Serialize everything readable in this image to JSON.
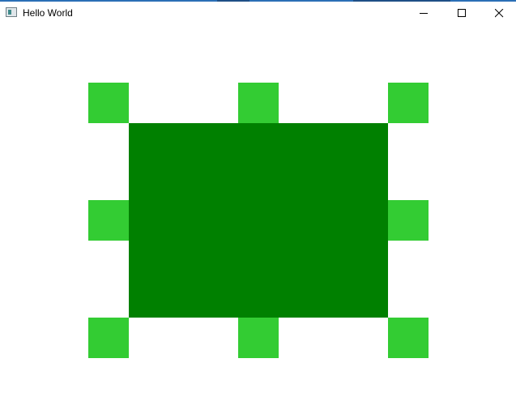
{
  "window": {
    "title": "Hello World",
    "icon": "app-window-icon",
    "controls": [
      "minimize-icon",
      "maximize-icon",
      "close-icon"
    ]
  },
  "canvas": {
    "shape_color": "#008000",
    "handle_color": "#33cc33",
    "handle_icons": [
      "resize-handle-top-left",
      "resize-handle-top",
      "resize-handle-top-right",
      "resize-handle-left",
      "resize-handle-right",
      "resize-handle-bottom-left",
      "resize-handle-bottom",
      "resize-handle-bottom-right"
    ]
  },
  "colors": {
    "accent": "#2b6fb6",
    "background": "#ffffff"
  }
}
